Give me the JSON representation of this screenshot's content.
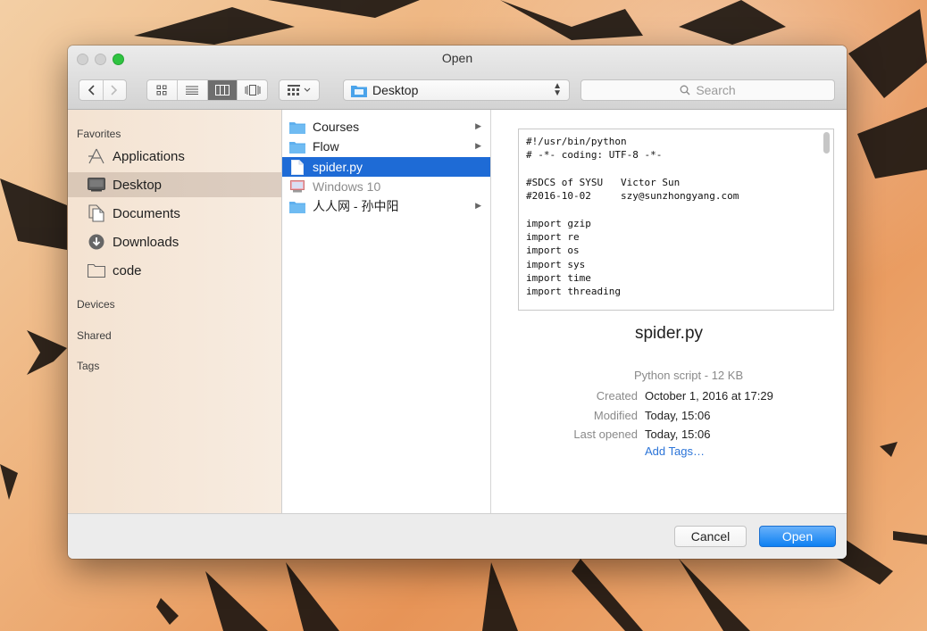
{
  "window": {
    "title": "Open"
  },
  "toolbar": {
    "location": "Desktop",
    "search_placeholder": "Search"
  },
  "sidebar": {
    "sections": {
      "favorites": "Favorites",
      "devices": "Devices",
      "shared": "Shared",
      "tags": "Tags"
    },
    "items": [
      {
        "label": "Applications",
        "icon": "applications-icon",
        "selected": false
      },
      {
        "label": "Desktop",
        "icon": "desktop-icon",
        "selected": true
      },
      {
        "label": "Documents",
        "icon": "documents-icon",
        "selected": false
      },
      {
        "label": "Downloads",
        "icon": "downloads-icon",
        "selected": false
      },
      {
        "label": "code",
        "icon": "folder-icon",
        "selected": false
      }
    ]
  },
  "files": [
    {
      "name": "Courses",
      "type": "folder",
      "has_children": true
    },
    {
      "name": "Flow",
      "type": "folder",
      "has_children": true
    },
    {
      "name": "spider.py",
      "type": "file",
      "selected": true
    },
    {
      "name": "Windows 10",
      "type": "disk-image",
      "dimmed": true
    },
    {
      "name": "人人网 - 孙中阳",
      "type": "folder",
      "has_children": true
    }
  ],
  "preview": {
    "code_lines": [
      "#!/usr/bin/python",
      "# -*- coding: UTF-8 -*-",
      "",
      "#SDCS of SYSU   Victor Sun",
      "#2016-10-02     szy@sunzhongyang.com",
      "",
      "import gzip",
      "import re",
      "import os",
      "import sys",
      "import time",
      "import threading"
    ],
    "name": "spider.py",
    "kind": "Python script - 12 KB",
    "meta": [
      {
        "key": "Created",
        "value": "October 1, 2016 at 17:29"
      },
      {
        "key": "Modified",
        "value": "Today, 15:06"
      },
      {
        "key": "Last opened",
        "value": "Today, 15:06"
      }
    ],
    "add_tags": "Add Tags…"
  },
  "buttons": {
    "cancel": "Cancel",
    "open": "Open"
  },
  "colors": {
    "accent": "#1e6bd6",
    "folder": "#5fb0ee",
    "link": "#2b74d8"
  }
}
